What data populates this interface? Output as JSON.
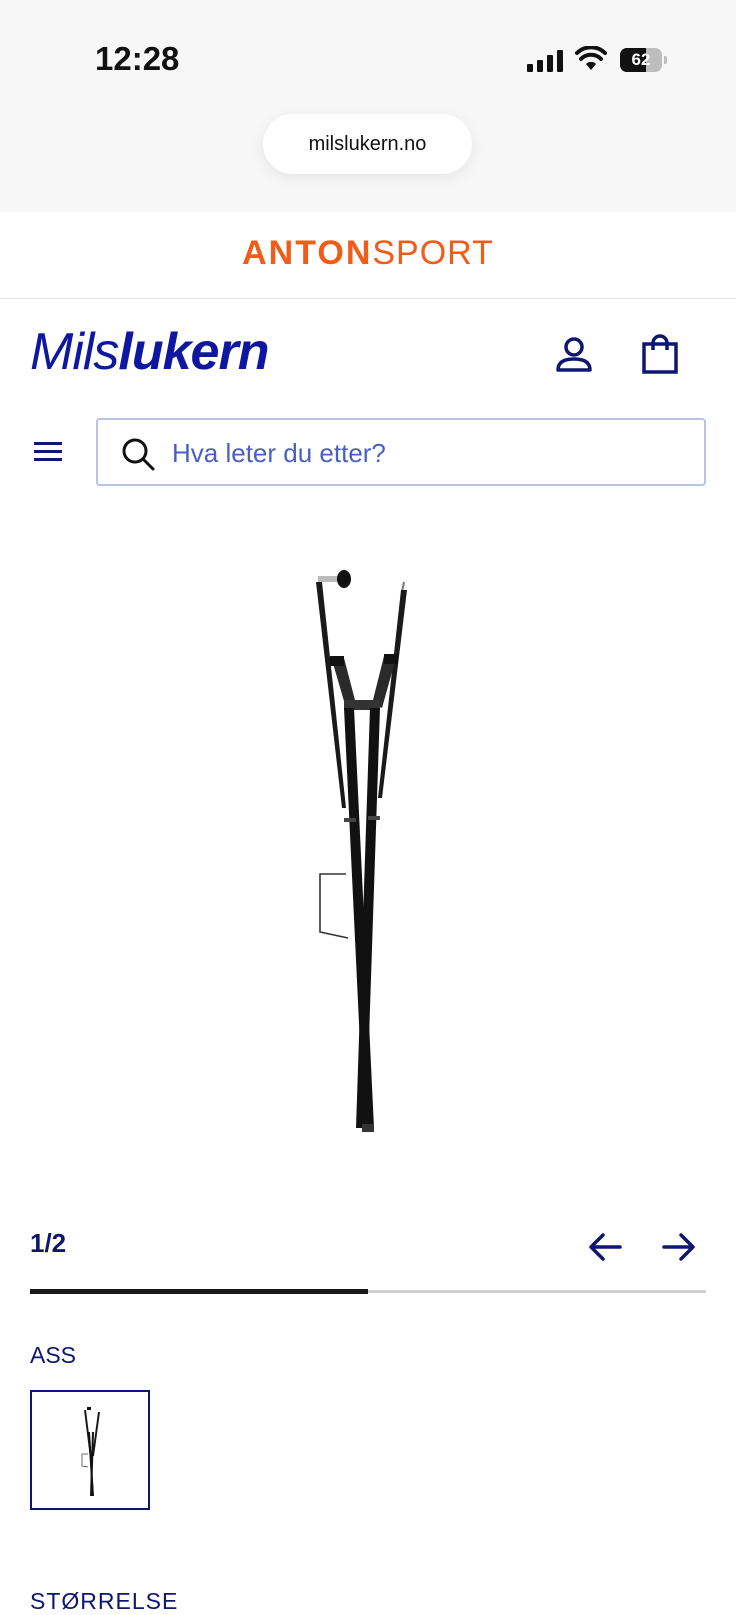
{
  "status_bar": {
    "time": "12:28",
    "battery_level": "62",
    "battery_fraction": 0.62
  },
  "browser": {
    "url": "milslukern.no"
  },
  "banner": {
    "brand_bold": "ANTON",
    "brand_light": "SPORT",
    "color": "#f25c19"
  },
  "header": {
    "logo_light": "Mils",
    "logo_bold": "lukern",
    "logo_color": "#0e17a0",
    "account_icon": "user-icon",
    "cart_icon": "shopping-bag-icon",
    "menu_icon": "hamburger-icon"
  },
  "search": {
    "placeholder": "Hva leter du etter?",
    "icon": "search-icon"
  },
  "gallery": {
    "counter": "1/2",
    "current": 1,
    "total": 2,
    "progress_fraction": 0.5,
    "prev_icon": "arrow-left-icon",
    "next_icon": "arrow-right-icon"
  },
  "variant": {
    "label": "ASS"
  },
  "size": {
    "label": "STØRRELSE"
  }
}
